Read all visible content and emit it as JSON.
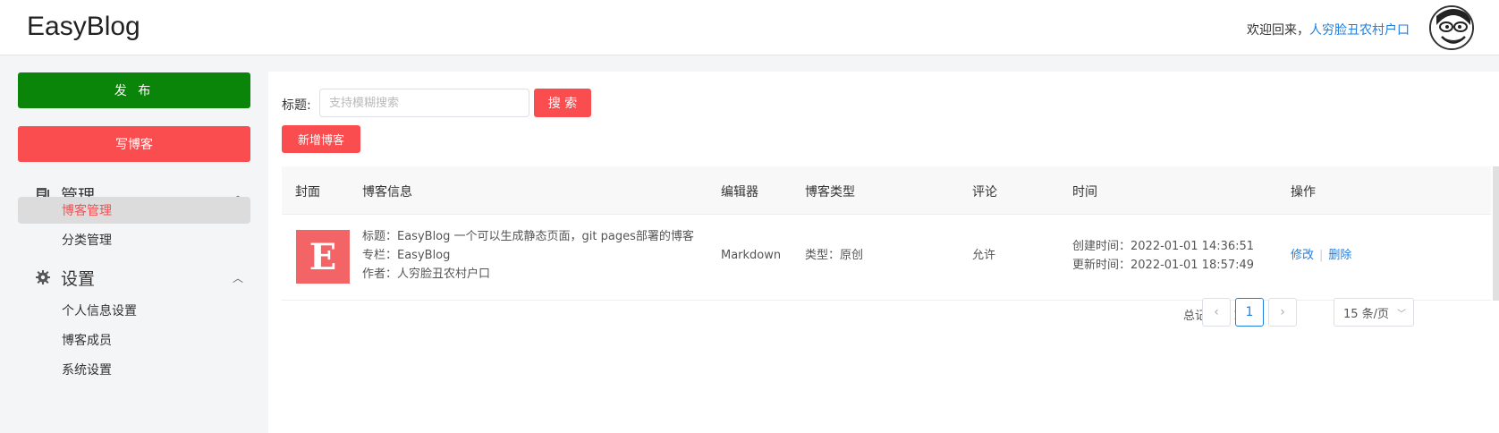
{
  "header": {
    "logo": "EasyBlog",
    "welcome_prefix": "欢迎回来，",
    "username": "人穷脸丑农村户口"
  },
  "sidebar": {
    "publish_label": "发 布",
    "write_label": "写博客",
    "groups": [
      {
        "title": "管理",
        "icon": "document-icon",
        "items": [
          {
            "label": "博客管理",
            "active": true
          },
          {
            "label": "分类管理",
            "active": false
          }
        ]
      },
      {
        "title": "设置",
        "icon": "gear-icon",
        "items": [
          {
            "label": "个人信息设置",
            "active": false
          },
          {
            "label": "博客成员",
            "active": false
          },
          {
            "label": "系统设置",
            "active": false
          }
        ]
      }
    ]
  },
  "search": {
    "label": "标题:",
    "placeholder": "支持模糊搜索",
    "value": "",
    "button": "搜 索"
  },
  "add_button": "新增博客",
  "table": {
    "headers": [
      "封面",
      "博客信息",
      "编辑器",
      "博客类型",
      "评论",
      "时间",
      "操作"
    ],
    "rows": [
      {
        "cover_letter": "E",
        "title": "标题：EasyBlog 一个可以生成静态页面，git pages部署的博客",
        "column": "专栏：EasyBlog",
        "author": "作者：人穷脸丑农村户口",
        "editor": "Markdown",
        "type": "类型：原创",
        "comment": "允许",
        "created": "创建时间：2022-01-01 14:36:51",
        "updated": "更新时间：2022-01-01 18:57:49",
        "edit": "修改",
        "delete": "删除"
      }
    ]
  },
  "pagination": {
    "total": "总记录数 1",
    "current_page": "1",
    "page_size": "15 条/页"
  },
  "colors": {
    "accent_red": "#fa4d4f",
    "publish_green": "#0a850a",
    "link_blue": "#1e7fe0"
  }
}
